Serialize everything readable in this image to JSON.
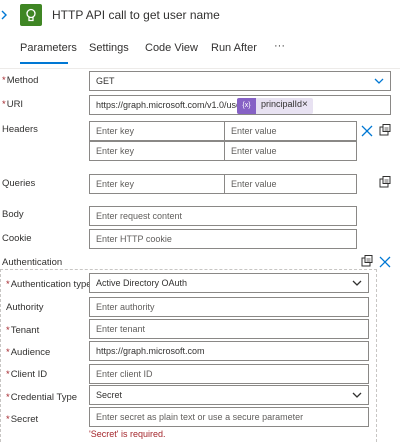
{
  "header": {
    "title": "HTTP API call to get user name",
    "tile_color": "#3f8624"
  },
  "tabs": [
    {
      "label": "Parameters",
      "active": true
    },
    {
      "label": "Settings",
      "active": false
    },
    {
      "label": "Code View",
      "active": false
    },
    {
      "label": "Run After",
      "active": false
    },
    {
      "label": "···",
      "active": false
    }
  ],
  "form": {
    "method": {
      "label": "Method",
      "value": "GET"
    },
    "uri": {
      "label": "URI",
      "value": "https://graph.microsoft.com/v1.0/users/",
      "token": "principalId",
      "token_symbol": "{x}"
    },
    "headers": {
      "label": "Headers",
      "key_placeholder": "Enter key",
      "value_placeholder": "Enter value"
    },
    "queries": {
      "label": "Queries",
      "key_placeholder": "Enter key",
      "value_placeholder": "Enter value"
    },
    "body": {
      "label": "Body",
      "placeholder": "Enter request content"
    },
    "cookie": {
      "label": "Cookie",
      "placeholder": "Enter HTTP cookie"
    },
    "authentication": {
      "label": "Authentication",
      "type": {
        "label": "Authentication type",
        "value": "Active Directory OAuth"
      },
      "authority": {
        "label": "Authority",
        "placeholder": "Enter authority"
      },
      "tenant": {
        "label": "Tenant",
        "placeholder": "Enter tenant"
      },
      "audience": {
        "label": "Audience",
        "value": "https://graph.microsoft.com"
      },
      "client_id": {
        "label": "Client ID",
        "placeholder": "Enter client ID"
      },
      "credential_type": {
        "label": "Credential Type",
        "value": "Secret"
      },
      "secret": {
        "label": "Secret",
        "placeholder": "Enter secret as plain text or use a secure parameter",
        "error": "'Secret' is required."
      }
    },
    "required_mark": "*"
  },
  "colors": {
    "accent": "#0078d4",
    "token": "#8661c5",
    "error": "#a4262c"
  }
}
